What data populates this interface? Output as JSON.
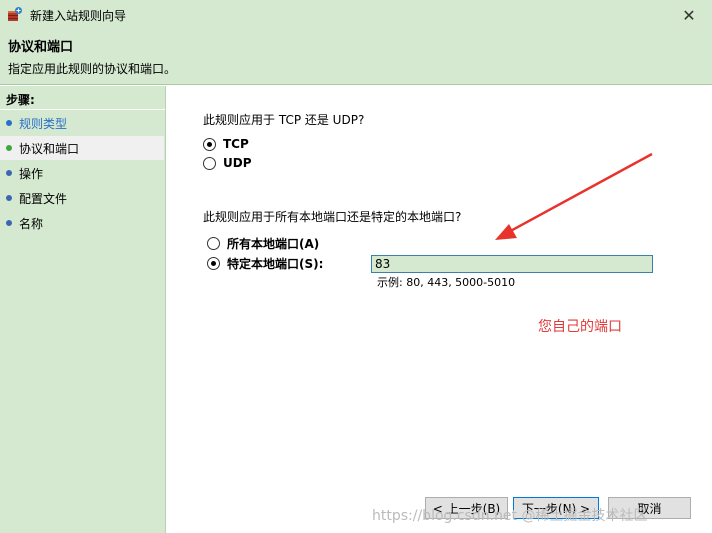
{
  "window": {
    "title": "新建入站规则向导",
    "close_glyph": "✕"
  },
  "header": {
    "title": "协议和端口",
    "subtitle": "指定应用此规则的协议和端口。"
  },
  "sidebar": {
    "heading": "步骤:",
    "items": [
      {
        "label": "规则类型",
        "color": "#2a6fc9",
        "active": false
      },
      {
        "label": "协议和端口",
        "color": "#3aa83a",
        "active": true
      },
      {
        "label": "操作",
        "color": "#3c66b3",
        "active": false
      },
      {
        "label": "配置文件",
        "color": "#3c66b3",
        "active": false
      },
      {
        "label": "名称",
        "color": "#3c66b3",
        "active": false
      }
    ]
  },
  "protocol": {
    "question": "此规则应用于 TCP 还是 UDP?",
    "options": [
      {
        "label": "TCP",
        "checked": true
      },
      {
        "label": "UDP",
        "checked": false
      }
    ]
  },
  "ports": {
    "question": "此规则应用于所有本地端口还是特定的本地端口?",
    "all_label": "所有本地端口(A)",
    "specific_label": "特定本地端口(S):",
    "all_checked": false,
    "specific_checked": true,
    "value": "83",
    "example": "示例: 80, 443, 5000-5010"
  },
  "annotation": {
    "text": "您自己的端口",
    "color": "#e03a3a"
  },
  "buttons": {
    "back": "< 上一步(B)",
    "next": "下一步(N) >",
    "cancel": "取消"
  },
  "watermark": "https://blog.csdn.net @稀土掘金技术社区"
}
